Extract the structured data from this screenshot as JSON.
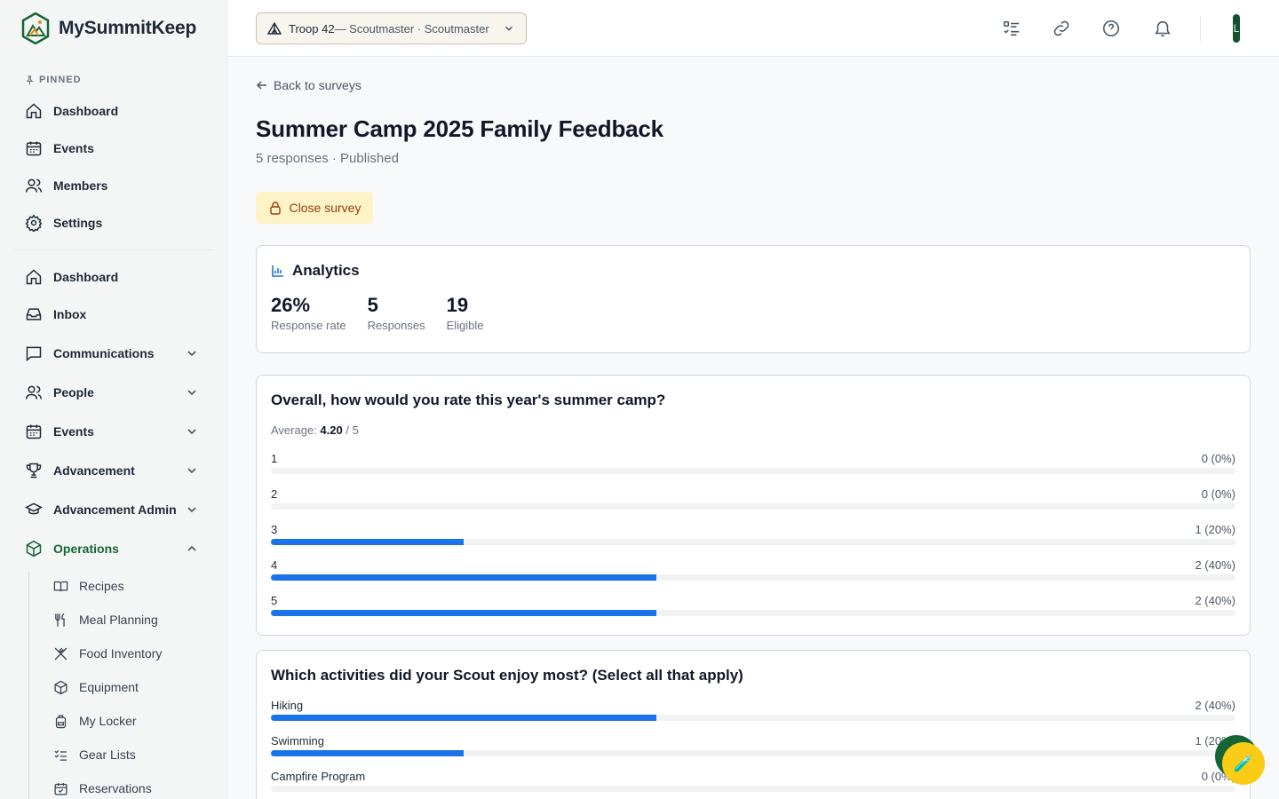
{
  "brand": {
    "name": "MySummitKeep"
  },
  "sidebar": {
    "pinned_label": "PINNED",
    "pinned": [
      {
        "label": "Dashboard",
        "icon": "home-icon"
      },
      {
        "label": "Events",
        "icon": "calendar-icon"
      },
      {
        "label": "Members",
        "icon": "users-icon"
      },
      {
        "label": "Settings",
        "icon": "gear-icon"
      }
    ],
    "main": [
      {
        "label": "Dashboard",
        "icon": "home-icon"
      },
      {
        "label": "Inbox",
        "icon": "inbox-icon"
      },
      {
        "label": "Communications",
        "icon": "chat-icon"
      },
      {
        "label": "People",
        "icon": "users-icon"
      },
      {
        "label": "Events",
        "icon": "calendar-icon"
      },
      {
        "label": "Advancement",
        "icon": "trophy-icon"
      },
      {
        "label": "Advancement Admin",
        "icon": "graduation-cap-icon"
      },
      {
        "label": "Operations",
        "icon": "package-icon"
      }
    ],
    "operations_sub": [
      {
        "label": "Recipes"
      },
      {
        "label": "Meal Planning"
      },
      {
        "label": "Food Inventory"
      },
      {
        "label": "Equipment"
      },
      {
        "label": "My Locker"
      },
      {
        "label": "Gear Lists"
      },
      {
        "label": "Reservations"
      }
    ]
  },
  "topbar": {
    "unit_name": "Troop 42",
    "unit_role": " — Scoutmaster · Scoutmaster",
    "avatar_initial": "L"
  },
  "page": {
    "back_label": "Back to surveys",
    "title": "Summer Camp 2025 Family Feedback",
    "subtitle": "5 responses · Published",
    "close_button": "Close survey"
  },
  "analytics": {
    "heading": "Analytics",
    "stats": [
      {
        "value": "26%",
        "label": "Response rate"
      },
      {
        "value": "5",
        "label": "Responses"
      },
      {
        "value": "19",
        "label": "Eligible"
      }
    ]
  },
  "questions": [
    {
      "title": "Overall, how would you rate this year's summer camp?",
      "average_prefix": "Average: ",
      "average_value": "4.20",
      "average_suffix": " / 5",
      "options": [
        {
          "label": "1",
          "count": "0 (0%)",
          "percent": 0
        },
        {
          "label": "2",
          "count": "0 (0%)",
          "percent": 0
        },
        {
          "label": "3",
          "count": "1 (20%)",
          "percent": 20
        },
        {
          "label": "4",
          "count": "2 (40%)",
          "percent": 40
        },
        {
          "label": "5",
          "count": "2 (40%)",
          "percent": 40
        }
      ]
    },
    {
      "title": "Which activities did your Scout enjoy most? (Select all that apply)",
      "options": [
        {
          "label": "Hiking",
          "count": "2 (40%)",
          "percent": 40
        },
        {
          "label": "Swimming",
          "count": "1 (20%)",
          "percent": 20
        },
        {
          "label": "Campfire Program",
          "count": "0 (0%)",
          "percent": 0
        }
      ]
    }
  ],
  "colors": {
    "bar": "#1a73e8",
    "brand_green": "#166534",
    "close_bg": "#fef3c7"
  }
}
